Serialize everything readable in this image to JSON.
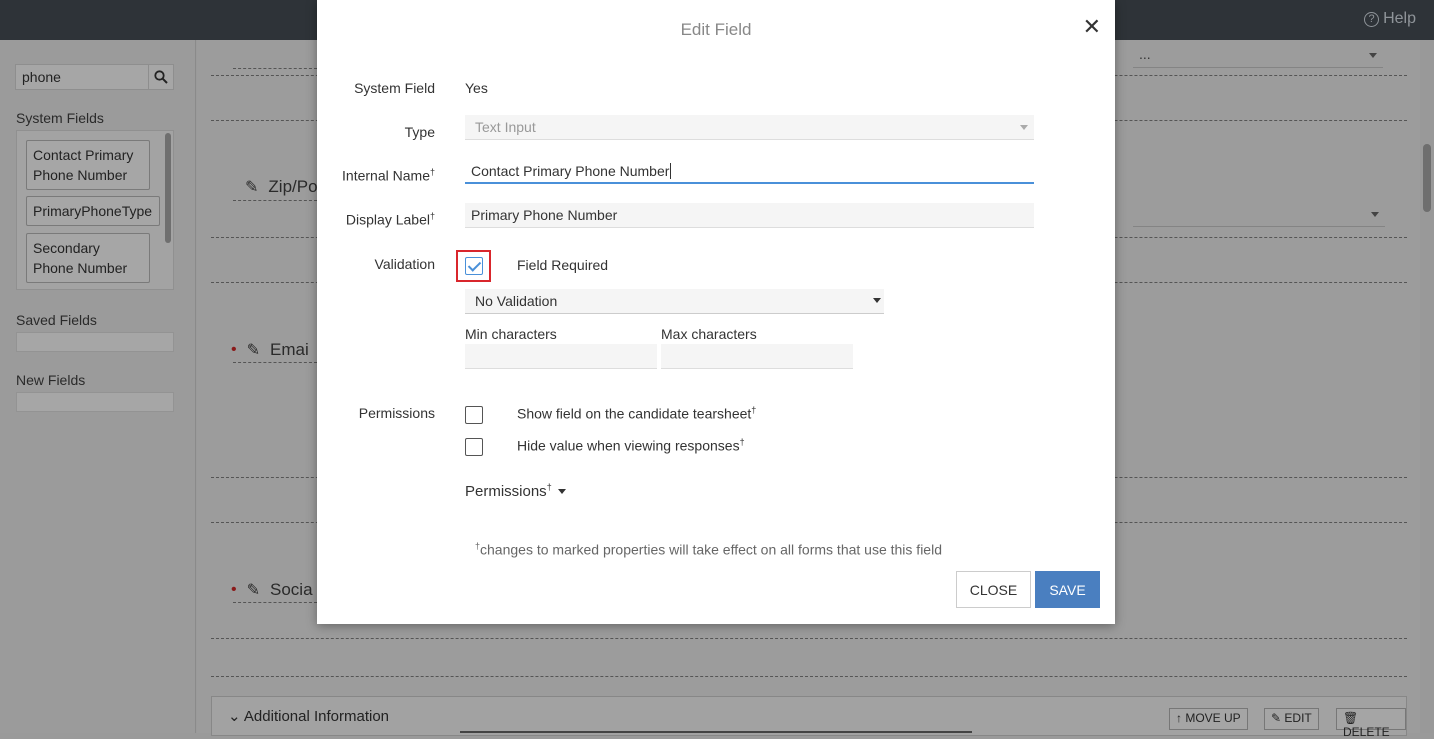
{
  "topbar": {
    "help_label": "Help",
    "help_icon": "question-circle-icon"
  },
  "sidebar": {
    "search_value": "phone",
    "system_fields_heading": "System Fields",
    "system_fields": [
      "Contact Primary Phone Number",
      "PrimaryPhoneType",
      "Secondary Phone Number"
    ],
    "saved_fields_heading": "Saved Fields",
    "new_fields_heading": "New Fields"
  },
  "background": {
    "top_dropdown_value": "...",
    "field_zip": "Zip/Po",
    "field_email": "Emai",
    "field_social": "Socia",
    "section_title": "Additional Information",
    "move_up_label": "MOVE UP",
    "edit_label": "EDIT",
    "delete_label": "DELETE"
  },
  "modal": {
    "title": "Edit Field",
    "system_field_label": "System Field",
    "system_field_value": "Yes",
    "type_label": "Type",
    "type_value": "Text Input",
    "internal_name_label": "Internal Name",
    "internal_name_value": "Contact Primary Phone Number",
    "display_label_label": "Display Label",
    "display_label_value": "Primary Phone Number",
    "validation_label": "Validation",
    "field_required_label": "Field Required",
    "field_required_checked": true,
    "validation_select_value": "No Validation",
    "min_chars_label": "Min characters",
    "max_chars_label": "Max characters",
    "permissions_label": "Permissions",
    "show_tearsheet_label": "Show field on the candidate tearsheet",
    "hide_value_label": "Hide value when viewing responses",
    "permissions_toggle": "Permissions",
    "dagger": "†",
    "footnote": "changes to marked properties will take effect on all forms that use this field",
    "close_button": "CLOSE",
    "save_button": "SAVE",
    "accent_color": "#4a7fc0",
    "highlight_color": "#d9262c"
  }
}
